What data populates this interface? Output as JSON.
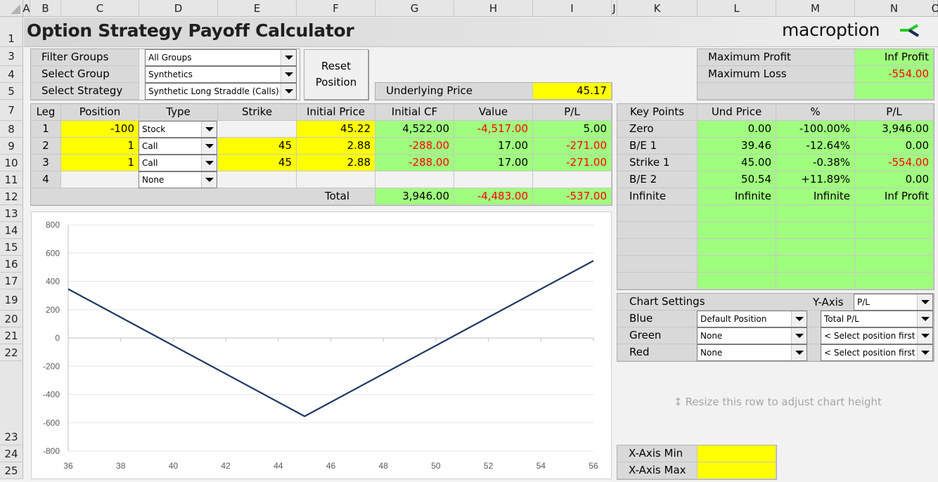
{
  "window": {
    "title": "Option Strategy Payoff Calculator",
    "brand": "macroption"
  },
  "sheet": {
    "columns": [
      "A",
      "B",
      "C",
      "D",
      "E",
      "F",
      "G",
      "H",
      "I",
      "J",
      "K",
      "L",
      "M",
      "N",
      "O"
    ],
    "rows": [
      "1",
      "3",
      "4",
      "5",
      "7",
      "8",
      "9",
      "10",
      "11",
      "12",
      "13",
      "14",
      "15",
      "16",
      "17",
      "19",
      "20",
      "21",
      "22",
      "23",
      "24",
      "25"
    ]
  },
  "controls": {
    "filter_groups_label": "Filter Groups",
    "filter_groups_value": "All Groups",
    "select_group_label": "Select Group",
    "select_group_value": "Synthetics",
    "select_strategy_label": "Select Strategy",
    "select_strategy_value": "Synthetic Long Straddle (Calls)",
    "reset_button_line1": "Reset",
    "reset_button_line2": "Position",
    "underlying_price_label": "Underlying Price",
    "underlying_price_value": "45.17"
  },
  "summary": {
    "max_profit_label": "Maximum Profit",
    "max_profit_value": "Inf Profit",
    "max_loss_label": "Maximum Loss",
    "max_loss_value": "-554.00"
  },
  "legs_table": {
    "headers": [
      "Leg",
      "Position",
      "Type",
      "Strike",
      "Initial Price",
      "Initial CF",
      "Value",
      "P/L"
    ],
    "rows": [
      {
        "leg": "1",
        "position": "-100",
        "type": "Stock",
        "strike": "",
        "initial_price": "45.22",
        "initial_cf": "4,522.00",
        "value": "-4,517.00",
        "pl": "5.00"
      },
      {
        "leg": "2",
        "position": "1",
        "type": "Call",
        "strike": "45",
        "initial_price": "2.88",
        "initial_cf": "-288.00",
        "value": "17.00",
        "pl": "-271.00"
      },
      {
        "leg": "3",
        "position": "1",
        "type": "Call",
        "strike": "45",
        "initial_price": "2.88",
        "initial_cf": "-288.00",
        "value": "17.00",
        "pl": "-271.00"
      },
      {
        "leg": "4",
        "position": "",
        "type": "None",
        "strike": "",
        "initial_price": "",
        "initial_cf": "",
        "value": "",
        "pl": ""
      }
    ],
    "total_label": "Total",
    "total_initial_cf": "3,946.00",
    "total_value": "-4,483.00",
    "total_pl": "-537.00"
  },
  "key_points": {
    "headers": [
      "Key Points",
      "Und Price",
      "%",
      "P/L"
    ],
    "rows": [
      {
        "name": "Zero",
        "und_price": "0.00",
        "pct": "-100.00%",
        "pl": "3,946.00"
      },
      {
        "name": "B/E 1",
        "und_price": "39.46",
        "pct": "-12.64%",
        "pl": "0.00"
      },
      {
        "name": "Strike 1",
        "und_price": "45.00",
        "pct": "-0.38%",
        "pl": "-554.00"
      },
      {
        "name": "B/E 2",
        "und_price": "50.54",
        "pct": "+11.89%",
        "pl": "0.00"
      },
      {
        "name": "Infinite",
        "und_price": "Infinite",
        "pct": "Infinite",
        "pl": "Inf Profit"
      }
    ]
  },
  "chart_settings": {
    "title": "Chart Settings",
    "y_axis_label": "Y-Axis",
    "y_axis_value": "P/L",
    "blue_label": "Blue",
    "blue_position": "Default Position",
    "blue_series": "Total P/L",
    "green_label": "Green",
    "green_position": "None",
    "green_series": "< Select position first",
    "red_label": "Red",
    "red_position": "None",
    "red_series": "< Select position first",
    "resize_hint": "Resize this row to adjust chart height",
    "x_axis_min_label": "X-Axis Min",
    "x_axis_min_value": "",
    "x_axis_max_label": "X-Axis Max",
    "x_axis_max_value": ""
  },
  "colors": {
    "input_yellow": "#ffff00",
    "output_green": "#a0fe7f",
    "label_gray": "#d9d9d9",
    "negative_red": "#ff0000",
    "series_blue": "#1f3864"
  },
  "chart_data": {
    "type": "line",
    "title": "",
    "xlabel": "",
    "ylabel": "",
    "xlim": [
      36,
      56
    ],
    "ylim": [
      -800,
      800
    ],
    "xticks": [
      "36",
      "38",
      "40",
      "42",
      "44",
      "46",
      "48",
      "50",
      "52",
      "54",
      "56"
    ],
    "yticks": [
      "800",
      "600",
      "400",
      "200",
      "0",
      "-200",
      "-400",
      "-600",
      "-800"
    ],
    "grid": "horizontal",
    "legend": "none",
    "series": [
      {
        "name": "Total P/L",
        "color": "#1f3864",
        "x": [
          36,
          39.46,
          45,
          50.54,
          56
        ],
        "y": [
          346,
          0,
          -554,
          0,
          546
        ]
      }
    ]
  }
}
